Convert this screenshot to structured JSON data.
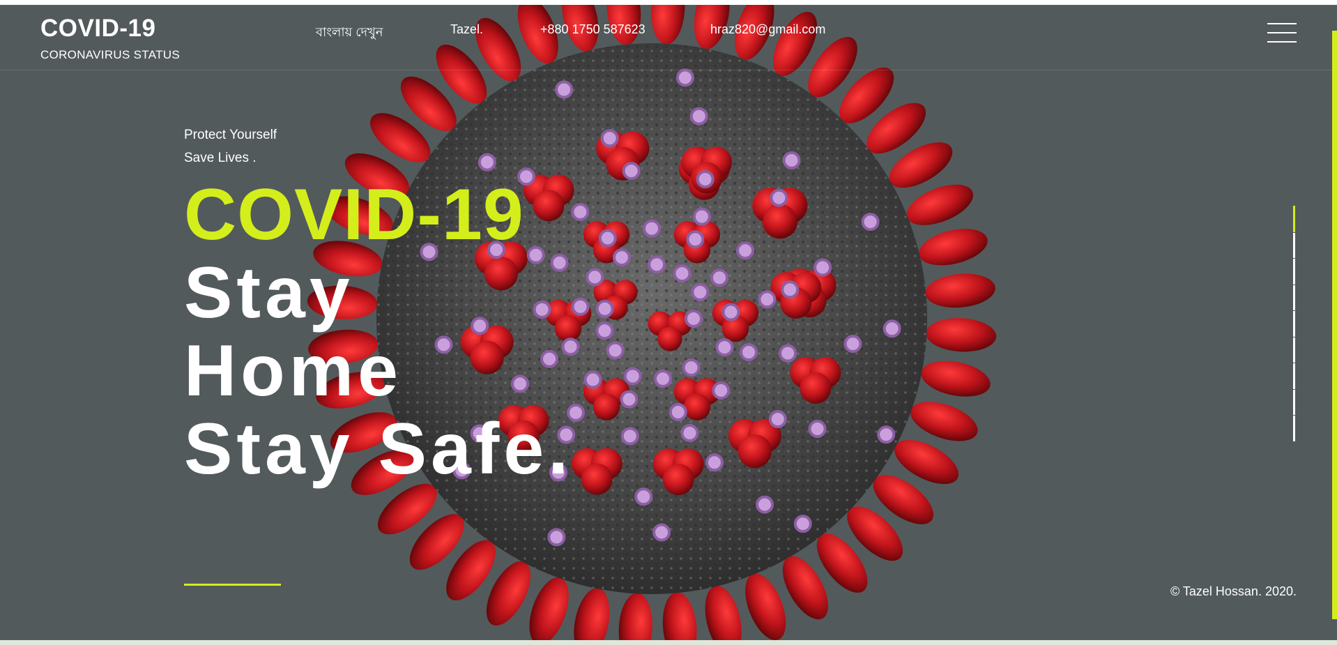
{
  "header": {
    "brand_title": "COVID-19",
    "brand_subtitle": "CORONAVIRUS STATUS",
    "nav": [
      {
        "label": "বাংলায় দেখুন"
      },
      {
        "label": "Tazel."
      },
      {
        "label": "+880 1750 587623"
      },
      {
        "label": "hraz820@gmail.com"
      }
    ],
    "menu_icon": "hamburger-menu-icon"
  },
  "hero": {
    "tagline_line1": "Protect Yourself",
    "tagline_line2": "Save Lives .",
    "headline_accent": "COVID-19",
    "headline_line1": "Stay",
    "headline_line2": "Home",
    "headline_line3": "Stay Safe."
  },
  "footer": {
    "copyright": "© Tazel Hossan. 2020."
  },
  "slider": {
    "active_index": 1,
    "total": 9
  },
  "colors": {
    "accent": "#d4ee1c",
    "background": "#535a5c",
    "virus_spike": "#c0141b",
    "virus_body": "#4a4a4a",
    "virus_receptor": "#c9a0dc"
  }
}
